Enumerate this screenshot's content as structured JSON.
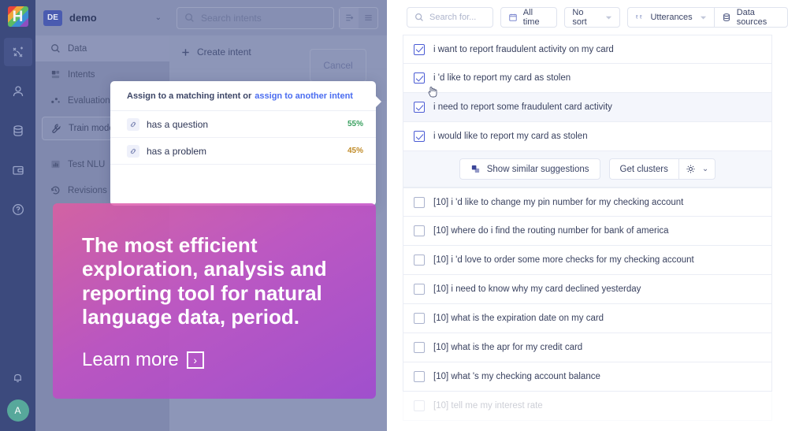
{
  "rail": {
    "logo_label": "H",
    "items": [
      {
        "name": "workflow-icon",
        "label": "Workflows",
        "active": true
      },
      {
        "name": "user-icon",
        "label": "Users",
        "active": false
      },
      {
        "name": "database-icon",
        "label": "Data",
        "active": false
      },
      {
        "name": "wallet-icon",
        "label": "Billing",
        "active": false
      },
      {
        "name": "help-icon",
        "label": "Help",
        "active": false
      }
    ],
    "bell_label": "Notifications",
    "avatar_initial": "A"
  },
  "project": {
    "badge": "DE",
    "name": "demo",
    "caret": "⌄"
  },
  "subnav": {
    "items": [
      {
        "label": "Data",
        "icon": "search-icon",
        "selected": true
      },
      {
        "label": "Intents",
        "icon": "intents-icon",
        "selected": false
      },
      {
        "label": "Evaluation",
        "icon": "evaluation-icon",
        "selected": false
      }
    ],
    "train_button": {
      "label": "Train model",
      "icon": "wrench-icon"
    },
    "items_bottom": [
      {
        "label": "Test NLU",
        "icon": "chart-icon"
      },
      {
        "label": "Revisions",
        "icon": "history-icon"
      }
    ]
  },
  "content": {
    "search_placeholder": "Search intents",
    "create_intent_label": "Create intent",
    "cancel_label": "Cancel"
  },
  "modal": {
    "title_static": "Assign to a matching intent or",
    "title_link": "assign to another intent",
    "rows": [
      {
        "label": "has a question",
        "percent": "55%",
        "tone": "green"
      },
      {
        "label": "has a problem",
        "percent": "45%",
        "tone": "amber"
      }
    ]
  },
  "promo": {
    "title": "The most efficient exploration, analysis and reporting tool for natural language data, period.",
    "cta": "Learn more",
    "cta_arrow": "›"
  },
  "right_panel": {
    "toolbar": {
      "search_placeholder": "Search for...",
      "date_filter": "All time",
      "sort_filter": "No sort",
      "utterances_filter": "Utterances",
      "data_sources": "Data sources"
    },
    "actions": {
      "show_similar": "Show similar suggestions",
      "get_clusters": "Get clusters",
      "settings_caret": "⌄"
    },
    "selected_rows": [
      {
        "text": "i want to report fraudulent activity on my card",
        "checked": true,
        "hovered": false
      },
      {
        "text": "i 'd like to report my card as stolen",
        "checked": true,
        "hovered": false
      },
      {
        "text": "i need to report some fraudulent card activity",
        "checked": true,
        "hovered": true
      },
      {
        "text": "i would like to report my card as stolen",
        "checked": true,
        "hovered": false
      }
    ],
    "suggestion_rows": [
      {
        "text": "[10] i 'd like to change my pin number for my checking account",
        "checked": false
      },
      {
        "text": "[10] where do i find the routing number for bank of america",
        "checked": false
      },
      {
        "text": "[10] i 'd love to order some more checks for my checking account",
        "checked": false
      },
      {
        "text": "[10] i need to know why my card declined yesterday",
        "checked": false
      },
      {
        "text": "[10] what is the expiration date on my card",
        "checked": false
      },
      {
        "text": "[10] what is the apr for my credit card",
        "checked": false
      },
      {
        "text": "[10] what 's my checking account balance",
        "checked": false
      },
      {
        "text": "[10] tell me my interest rate",
        "checked": false
      }
    ]
  },
  "colors": {
    "rail_bg": "#3c4a7d",
    "subnav_bg": "#8089ae",
    "dim_overlay": "#8d96b8",
    "accent_blue": "#4a5bd4",
    "link_blue": "#4a6cf0",
    "green": "#39a05f",
    "amber": "#c08b28",
    "promo_from": "#e45aa0",
    "promo_to": "#a246d0"
  }
}
